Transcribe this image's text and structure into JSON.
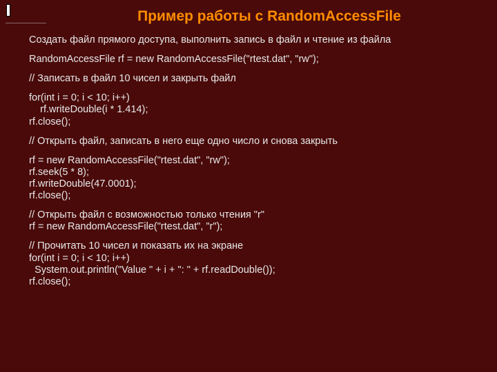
{
  "title": "Пример работы с RandomAccessFile",
  "p1": "Создать файл прямого доступа, выполнить запись в файл и чтение из файла",
  "p2": "RandomAccessFile rf = new RandomAccessFile(\"rtest.dat\", \"rw\");",
  "p3": "// Записать в файл 10 чисел и закрыть файл",
  "p4": "for(int i = 0; i < 10; i++)\n    rf.writeDouble(i * 1.414);\nrf.close();",
  "p5": "// Открыть файл, записать в него еще одно число и снова закрыть",
  "p6": "rf = new RandomAccessFile(\"rtest.dat\", \"rw\");\nrf.seek(5 * 8);\nrf.writeDouble(47.0001);\nrf.close();",
  "p7": "// Открыть файл с возможностью только чтения \"r\"\nrf = new RandomAccessFile(\"rtest.dat\", \"r\");",
  "p8": "// Прочитать 10 чисел и показать их на экране\nfor(int i = 0; i < 10; i++)\n  System.out.println(\"Value \" + i + \": \" + rf.readDouble());\nrf.close();"
}
